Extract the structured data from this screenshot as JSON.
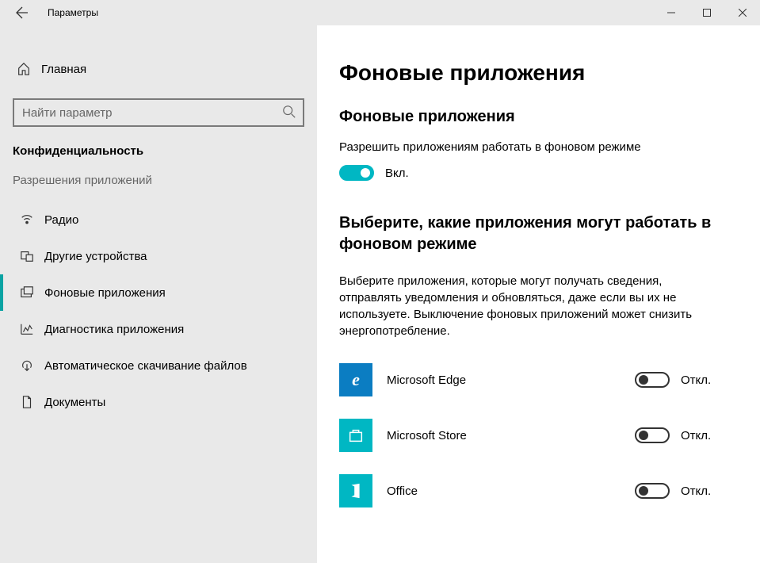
{
  "window": {
    "title": "Параметры"
  },
  "sidebar": {
    "home": "Главная",
    "search_placeholder": "Найти параметр",
    "category": "Конфиденциальность",
    "section_header": "Разрешения приложений",
    "items": [
      {
        "label": "Радио",
        "icon": "radio-icon",
        "active": false
      },
      {
        "label": "Другие устройства",
        "icon": "devices-icon",
        "active": false
      },
      {
        "label": "Фоновые приложения",
        "icon": "background-apps-icon",
        "active": true
      },
      {
        "label": "Диагностика приложения",
        "icon": "diagnostics-icon",
        "active": false
      },
      {
        "label": "Автоматическое скачивание файлов",
        "icon": "download-icon",
        "active": false
      },
      {
        "label": "Документы",
        "icon": "documents-icon",
        "active": false
      }
    ]
  },
  "main": {
    "page_title": "Фоновые приложения",
    "section1_title": "Фоновые приложения",
    "master_label": "Разрешить приложениям работать в фоновом режиме",
    "master_state": "Вкл.",
    "section2_title": "Выберите, какие приложения могут работать в фоновом режиме",
    "description": "Выберите приложения, которые могут получать сведения, отправлять уведомления и обновляться, даже если вы их не используете. Выключение фоновых приложений может снизить энергопотребление.",
    "off_label": "Откл.",
    "apps": [
      {
        "name": "Microsoft Edge",
        "icon_class": "ic-edge",
        "glyph": "e",
        "state": "Откл."
      },
      {
        "name": "Microsoft Store",
        "icon_class": "ic-store",
        "glyph": "",
        "state": "Откл."
      },
      {
        "name": "Office",
        "icon_class": "ic-office",
        "glyph": "",
        "state": "Откл."
      }
    ]
  }
}
